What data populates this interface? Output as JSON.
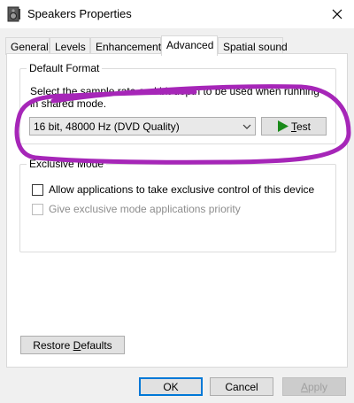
{
  "window": {
    "title": "Speakers Properties",
    "icon": "speaker-icon",
    "close_icon": "close-icon"
  },
  "tabs": [
    {
      "label": "General",
      "active": false
    },
    {
      "label": "Levels",
      "active": false
    },
    {
      "label": "Enhancements",
      "active": false
    },
    {
      "label": "Advanced",
      "active": true
    },
    {
      "label": "Spatial sound",
      "active": false
    }
  ],
  "default_format": {
    "group_label": "Default Format",
    "description": "Select the sample rate and bit depth to be used when running in shared mode.",
    "selected_format": "16 bit, 48000 Hz (DVD Quality)",
    "test_button": {
      "label_prefix": "",
      "label_accel": "T",
      "label_rest": "est",
      "icon": "play-icon"
    }
  },
  "exclusive_mode": {
    "group_label": "Exclusive Mode",
    "allow_exclusive": {
      "label": "Allow applications to take exclusive control of this device",
      "checked": false,
      "enabled": true
    },
    "exclusive_priority": {
      "label": "Give exclusive mode applications priority",
      "checked": false,
      "enabled": false
    }
  },
  "restore_defaults": {
    "label_prefix": "Restore ",
    "label_accel": "D",
    "label_rest": "efaults"
  },
  "footer": {
    "ok_label": "OK",
    "cancel_label": "Cancel",
    "apply_accel": "A",
    "apply_rest": "pply"
  },
  "colors": {
    "annotation_stroke": "#a626b8",
    "play_icon": "#1a8a1a",
    "default_button_border": "#0078d7"
  }
}
